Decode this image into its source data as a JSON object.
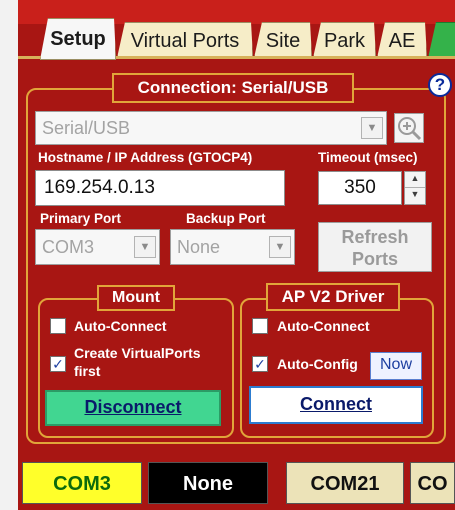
{
  "tabs": [
    {
      "label": "Setup",
      "active": true
    },
    {
      "label": "Virtual Ports"
    },
    {
      "label": "Site"
    },
    {
      "label": "Park"
    },
    {
      "label": "AE"
    }
  ],
  "help_label": "?",
  "connection": {
    "title": "Connection: Serial/USB",
    "mode_value": "Serial/USB",
    "hostname_label": "Hostname / IP Address (GTOCP4)",
    "hostname_value": "169.254.0.13",
    "timeout_label": "Timeout (msec)",
    "timeout_value": "350",
    "primary_port_label": "Primary Port",
    "primary_port_value": "COM3",
    "backup_port_label": "Backup Port",
    "backup_port_value": "None",
    "refresh_button": "Refresh Ports"
  },
  "mount": {
    "title": "Mount",
    "auto_connect_label": "Auto-Connect",
    "auto_connect_checked": false,
    "create_vp_label": "Create VirtualPorts first",
    "create_vp_checked": true,
    "disconnect_button": "Disconnect"
  },
  "ap_driver": {
    "title": "AP V2 Driver",
    "auto_connect_label": "Auto-Connect",
    "auto_connect_checked": false,
    "auto_config_label": "Auto-Config",
    "auto_config_checked": true,
    "now_button": "Now",
    "connect_button": "Connect"
  },
  "status_bar": [
    {
      "label": "COM3",
      "bg": "#ffff2a",
      "fg": "#0c6a0c"
    },
    {
      "label": "None",
      "bg": "#000000",
      "fg": "#ffffff"
    },
    {
      "label": "COM21",
      "bg": "#ece3b8",
      "fg": "#111111"
    },
    {
      "label": "CO",
      "bg": "#ece3b8",
      "fg": "#111111"
    }
  ],
  "colors": {
    "panel": "#a81613",
    "gold_border": "#e1a53a",
    "disconnect_green": "#41d691"
  }
}
